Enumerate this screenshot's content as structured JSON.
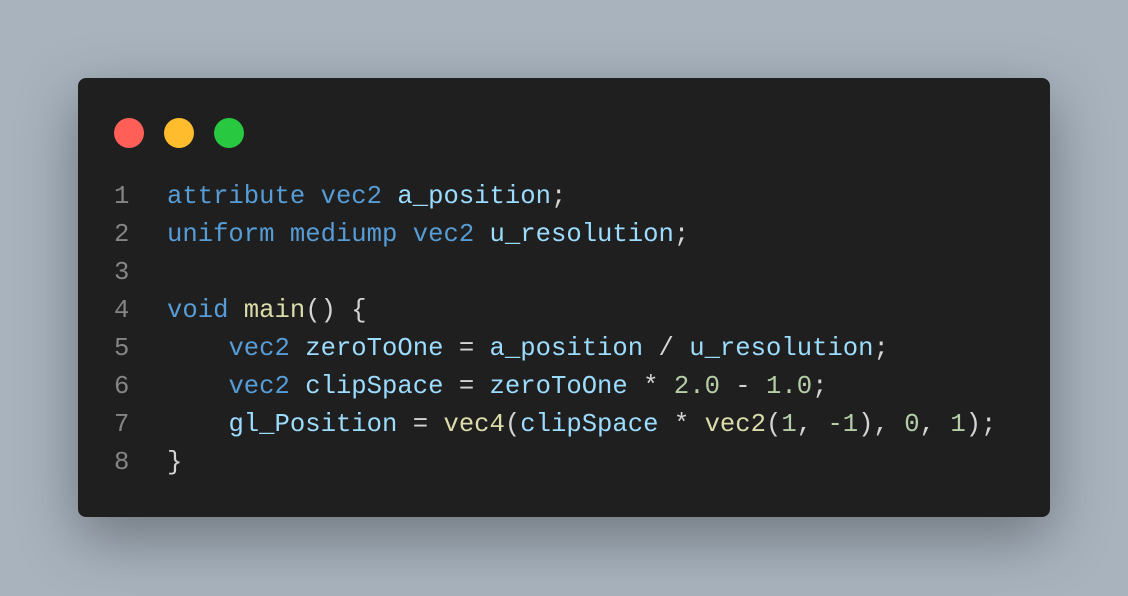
{
  "window_controls": [
    {
      "name": "close",
      "color": "#ff5f57"
    },
    {
      "name": "minimize",
      "color": "#ffbd2e"
    },
    {
      "name": "maximize",
      "color": "#28c840"
    }
  ],
  "code": {
    "lines": [
      {
        "number": "1",
        "tokens": [
          [
            "keyword",
            "attribute"
          ],
          [
            "punct",
            " "
          ],
          [
            "keyword",
            "vec2"
          ],
          [
            "punct",
            " "
          ],
          [
            "variable",
            "a_position"
          ],
          [
            "punct",
            ";"
          ]
        ]
      },
      {
        "number": "2",
        "tokens": [
          [
            "keyword",
            "uniform"
          ],
          [
            "punct",
            " "
          ],
          [
            "keyword",
            "mediump"
          ],
          [
            "punct",
            " "
          ],
          [
            "keyword",
            "vec2"
          ],
          [
            "punct",
            " "
          ],
          [
            "variable",
            "u_resolution"
          ],
          [
            "punct",
            ";"
          ]
        ]
      },
      {
        "number": "3",
        "tokens": []
      },
      {
        "number": "4",
        "tokens": [
          [
            "keyword",
            "void"
          ],
          [
            "punct",
            " "
          ],
          [
            "function",
            "main"
          ],
          [
            "punct",
            "() {"
          ]
        ]
      },
      {
        "number": "5",
        "tokens": [
          [
            "punct",
            "    "
          ],
          [
            "keyword",
            "vec2"
          ],
          [
            "punct",
            " "
          ],
          [
            "variable",
            "zeroToOne"
          ],
          [
            "punct",
            " = "
          ],
          [
            "variable",
            "a_position"
          ],
          [
            "punct",
            " / "
          ],
          [
            "variable",
            "u_resolution"
          ],
          [
            "punct",
            ";"
          ]
        ]
      },
      {
        "number": "6",
        "tokens": [
          [
            "punct",
            "    "
          ],
          [
            "keyword",
            "vec2"
          ],
          [
            "punct",
            " "
          ],
          [
            "variable",
            "clipSpace"
          ],
          [
            "punct",
            " = "
          ],
          [
            "variable",
            "zeroToOne"
          ],
          [
            "punct",
            " * "
          ],
          [
            "number",
            "2.0"
          ],
          [
            "punct",
            " - "
          ],
          [
            "number",
            "1.0"
          ],
          [
            "punct",
            ";"
          ]
        ]
      },
      {
        "number": "7",
        "tokens": [
          [
            "punct",
            "    "
          ],
          [
            "variable",
            "gl_Position"
          ],
          [
            "punct",
            " = "
          ],
          [
            "function",
            "vec4"
          ],
          [
            "punct",
            "("
          ],
          [
            "variable",
            "clipSpace"
          ],
          [
            "punct",
            " * "
          ],
          [
            "function",
            "vec2"
          ],
          [
            "punct",
            "("
          ],
          [
            "number",
            "1"
          ],
          [
            "punct",
            ", "
          ],
          [
            "number",
            "-1"
          ],
          [
            "punct",
            "), "
          ],
          [
            "number",
            "0"
          ],
          [
            "punct",
            ", "
          ],
          [
            "number",
            "1"
          ],
          [
            "punct",
            ");"
          ]
        ]
      },
      {
        "number": "8",
        "tokens": [
          [
            "punct",
            "}"
          ]
        ]
      }
    ]
  }
}
